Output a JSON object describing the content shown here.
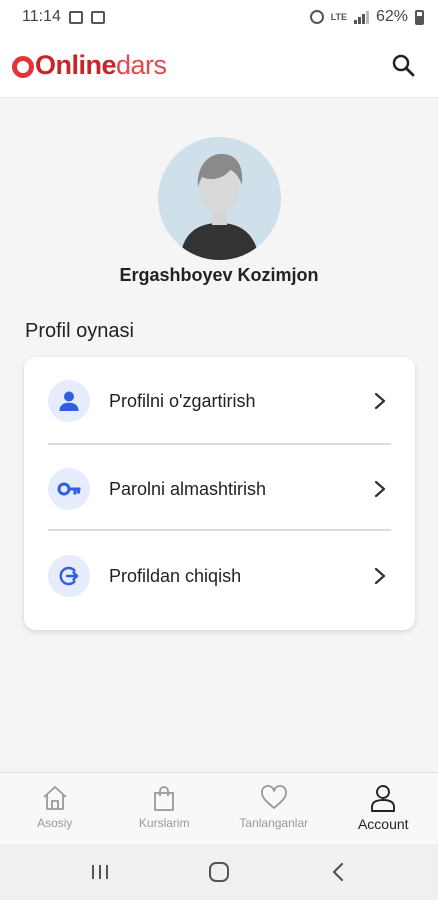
{
  "status_bar": {
    "time": "11:14",
    "battery": "62%",
    "icons": [
      "image-icon",
      "message-icon",
      "alarm-icon",
      "lte-icon",
      "signal-icon",
      "battery-icon"
    ]
  },
  "app_bar": {
    "logo_part1": "Online",
    "logo_part2": "dars",
    "search_icon": "search-icon"
  },
  "profile": {
    "name": "Ergashboyev Kozimjon"
  },
  "section": {
    "title": "Profil oynasi"
  },
  "menu": [
    {
      "label": "Profilni o'zgartirish",
      "icon": "person-icon"
    },
    {
      "label": "Parolni almashtirish",
      "icon": "key-icon"
    },
    {
      "label": "Profildan chiqish",
      "icon": "logout-icon"
    }
  ],
  "bottom_nav": [
    {
      "label": "Asosiy",
      "icon": "home-icon",
      "active": false
    },
    {
      "label": "Kurslarim",
      "icon": "bag-icon",
      "active": false
    },
    {
      "label": "Tanlanganlar",
      "icon": "heart-icon",
      "active": false
    },
    {
      "label": "Account",
      "icon": "account-icon",
      "active": true
    }
  ],
  "colors": {
    "brand_red": "#e53238",
    "icon_blue": "#2f5ee0",
    "icon_bg": "#e6ecfb"
  }
}
